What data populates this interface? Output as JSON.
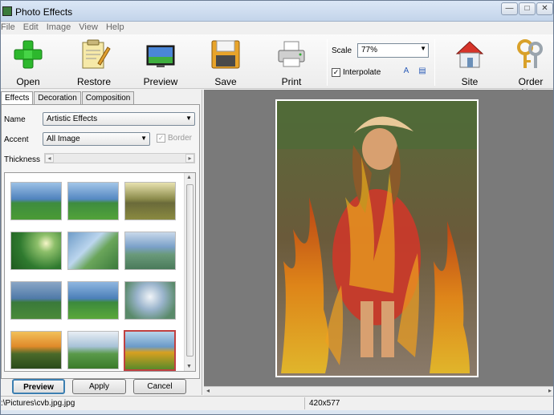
{
  "window": {
    "title": "Photo Effects",
    "min_label": "—",
    "max_label": "□",
    "close_label": "✕"
  },
  "menu": [
    "File",
    "Edit",
    "Image",
    "View",
    "Help"
  ],
  "toolbar": {
    "open": "Open",
    "restore": "Restore",
    "preview": "Preview",
    "save": "Save",
    "print": "Print",
    "scale_label": "Scale",
    "scale_value": "77%",
    "interpolate_label": "Interpolate",
    "site": "Site",
    "order_now": "Order Now"
  },
  "tabs": [
    "Effects",
    "Decoration",
    "Composition"
  ],
  "form": {
    "name_label": "Name",
    "name_value": "Artistic Effects",
    "accent_label": "Accent",
    "accent_value": "All Image",
    "border_label": "Border",
    "thickness_label": "Thickness"
  },
  "buttons": {
    "preview": "Preview",
    "apply": "Apply",
    "cancel": "Cancel"
  },
  "status": {
    "path": ":\\Pictures\\cvb.jpg.jpg",
    "size": "420x577"
  },
  "icons": [
    "plus-icon",
    "restore-icon",
    "preview-icon",
    "floppy-icon",
    "printer-icon",
    "font-icon",
    "page-icon",
    "house-icon",
    "keys-icon"
  ]
}
